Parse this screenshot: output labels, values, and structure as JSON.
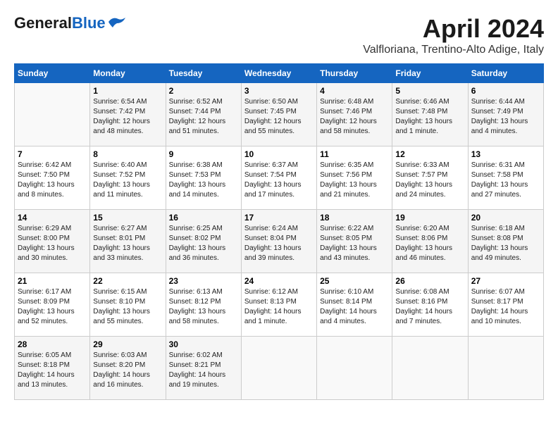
{
  "header": {
    "logo_line1": "General",
    "logo_line2": "Blue",
    "month": "April 2024",
    "location": "Valfloriana, Trentino-Alto Adige, Italy"
  },
  "days_of_week": [
    "Sunday",
    "Monday",
    "Tuesday",
    "Wednesday",
    "Thursday",
    "Friday",
    "Saturday"
  ],
  "weeks": [
    [
      {
        "num": "",
        "empty": true
      },
      {
        "num": "1",
        "sunrise": "6:54 AM",
        "sunset": "7:42 PM",
        "daylight": "12 hours and 48 minutes."
      },
      {
        "num": "2",
        "sunrise": "6:52 AM",
        "sunset": "7:44 PM",
        "daylight": "12 hours and 51 minutes."
      },
      {
        "num": "3",
        "sunrise": "6:50 AM",
        "sunset": "7:45 PM",
        "daylight": "12 hours and 55 minutes."
      },
      {
        "num": "4",
        "sunrise": "6:48 AM",
        "sunset": "7:46 PM",
        "daylight": "12 hours and 58 minutes."
      },
      {
        "num": "5",
        "sunrise": "6:46 AM",
        "sunset": "7:48 PM",
        "daylight": "13 hours and 1 minute."
      },
      {
        "num": "6",
        "sunrise": "6:44 AM",
        "sunset": "7:49 PM",
        "daylight": "13 hours and 4 minutes."
      }
    ],
    [
      {
        "num": "7",
        "sunrise": "6:42 AM",
        "sunset": "7:50 PM",
        "daylight": "13 hours and 8 minutes."
      },
      {
        "num": "8",
        "sunrise": "6:40 AM",
        "sunset": "7:52 PM",
        "daylight": "13 hours and 11 minutes."
      },
      {
        "num": "9",
        "sunrise": "6:38 AM",
        "sunset": "7:53 PM",
        "daylight": "13 hours and 14 minutes."
      },
      {
        "num": "10",
        "sunrise": "6:37 AM",
        "sunset": "7:54 PM",
        "daylight": "13 hours and 17 minutes."
      },
      {
        "num": "11",
        "sunrise": "6:35 AM",
        "sunset": "7:56 PM",
        "daylight": "13 hours and 21 minutes."
      },
      {
        "num": "12",
        "sunrise": "6:33 AM",
        "sunset": "7:57 PM",
        "daylight": "13 hours and 24 minutes."
      },
      {
        "num": "13",
        "sunrise": "6:31 AM",
        "sunset": "7:58 PM",
        "daylight": "13 hours and 27 minutes."
      }
    ],
    [
      {
        "num": "14",
        "sunrise": "6:29 AM",
        "sunset": "8:00 PM",
        "daylight": "13 hours and 30 minutes."
      },
      {
        "num": "15",
        "sunrise": "6:27 AM",
        "sunset": "8:01 PM",
        "daylight": "13 hours and 33 minutes."
      },
      {
        "num": "16",
        "sunrise": "6:25 AM",
        "sunset": "8:02 PM",
        "daylight": "13 hours and 36 minutes."
      },
      {
        "num": "17",
        "sunrise": "6:24 AM",
        "sunset": "8:04 PM",
        "daylight": "13 hours and 39 minutes."
      },
      {
        "num": "18",
        "sunrise": "6:22 AM",
        "sunset": "8:05 PM",
        "daylight": "13 hours and 43 minutes."
      },
      {
        "num": "19",
        "sunrise": "6:20 AM",
        "sunset": "8:06 PM",
        "daylight": "13 hours and 46 minutes."
      },
      {
        "num": "20",
        "sunrise": "6:18 AM",
        "sunset": "8:08 PM",
        "daylight": "13 hours and 49 minutes."
      }
    ],
    [
      {
        "num": "21",
        "sunrise": "6:17 AM",
        "sunset": "8:09 PM",
        "daylight": "13 hours and 52 minutes."
      },
      {
        "num": "22",
        "sunrise": "6:15 AM",
        "sunset": "8:10 PM",
        "daylight": "13 hours and 55 minutes."
      },
      {
        "num": "23",
        "sunrise": "6:13 AM",
        "sunset": "8:12 PM",
        "daylight": "13 hours and 58 minutes."
      },
      {
        "num": "24",
        "sunrise": "6:12 AM",
        "sunset": "8:13 PM",
        "daylight": "14 hours and 1 minute."
      },
      {
        "num": "25",
        "sunrise": "6:10 AM",
        "sunset": "8:14 PM",
        "daylight": "14 hours and 4 minutes."
      },
      {
        "num": "26",
        "sunrise": "6:08 AM",
        "sunset": "8:16 PM",
        "daylight": "14 hours and 7 minutes."
      },
      {
        "num": "27",
        "sunrise": "6:07 AM",
        "sunset": "8:17 PM",
        "daylight": "14 hours and 10 minutes."
      }
    ],
    [
      {
        "num": "28",
        "sunrise": "6:05 AM",
        "sunset": "8:18 PM",
        "daylight": "14 hours and 13 minutes."
      },
      {
        "num": "29",
        "sunrise": "6:03 AM",
        "sunset": "8:20 PM",
        "daylight": "14 hours and 16 minutes."
      },
      {
        "num": "30",
        "sunrise": "6:02 AM",
        "sunset": "8:21 PM",
        "daylight": "14 hours and 19 minutes."
      },
      {
        "num": "",
        "empty": true
      },
      {
        "num": "",
        "empty": true
      },
      {
        "num": "",
        "empty": true
      },
      {
        "num": "",
        "empty": true
      }
    ]
  ]
}
